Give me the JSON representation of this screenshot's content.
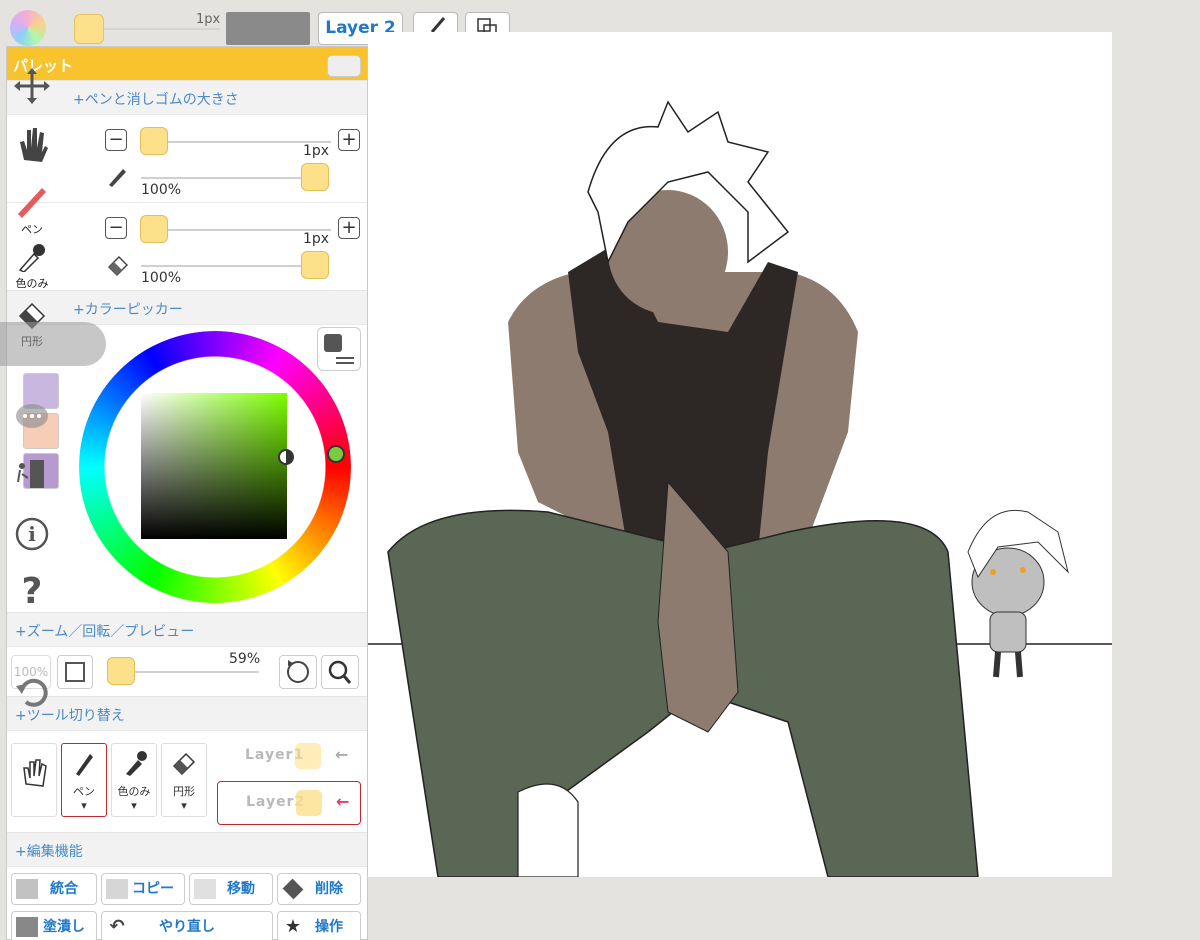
{
  "toolbar": {
    "brush_size": "1px",
    "current_color": "#8a8a8a",
    "layer_label": "Layer 2",
    "brush_settings_icon": "brush-settings-icon",
    "transform_icon": "transform-icon"
  },
  "palette": {
    "title": "パレット",
    "sections": {
      "size": "+ペンと消しゴムの大きさ",
      "picker": "+カラーピッカー",
      "zoom": "+ズーム／回転／プレビュー",
      "tools": "+ツール切り替え",
      "edit": "+編集機能"
    },
    "pen_size": "1px",
    "pen_opacity": "100%",
    "eraser_size": "1px",
    "eraser_opacity": "100%",
    "zoom_value": "59%",
    "zoom_reset": "100%",
    "tool_buttons": [
      {
        "label": ""
      },
      {
        "label": "ペン"
      },
      {
        "label": "色のみ"
      },
      {
        "label": "円形"
      }
    ],
    "layers": [
      "Layer1",
      "Layer2"
    ],
    "edit_buttons": [
      "統合",
      "コピー",
      "移動",
      "削除",
      "塗潰し",
      "やり直し",
      "操作"
    ],
    "swatches": [
      "#c9b7e0",
      "#f6cdb6",
      "#b79ad0"
    ]
  },
  "left_tools": {
    "pen_label": "ペン",
    "color_only_label": "色のみ",
    "circle_label": "円形"
  },
  "colors": {
    "accent": "#f8c32c",
    "link": "#1f78c8",
    "selected_border": "#c0292e"
  }
}
